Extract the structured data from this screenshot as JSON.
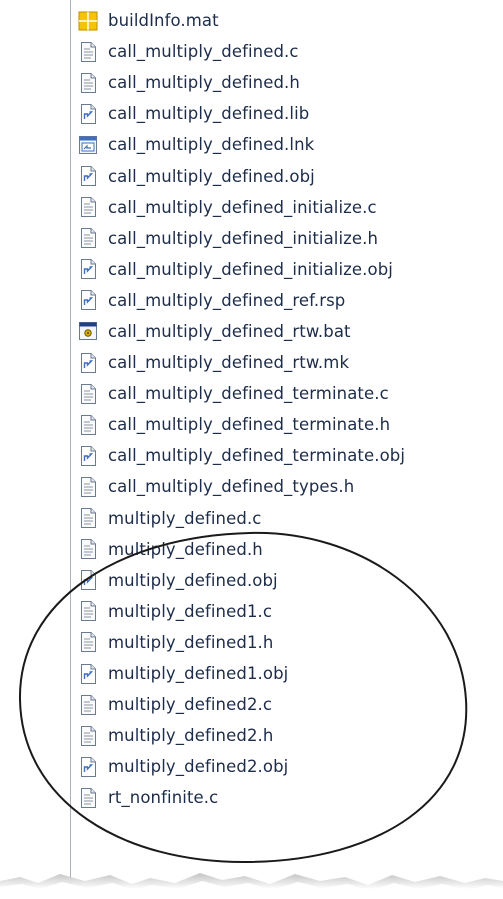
{
  "files": [
    {
      "name": "buildInfo.mat",
      "icon": "mat-file-icon"
    },
    {
      "name": "call_multiply_defined.c",
      "icon": "text-file-icon"
    },
    {
      "name": "call_multiply_defined.h",
      "icon": "text-file-icon"
    },
    {
      "name": "call_multiply_defined.lib",
      "icon": "object-file-icon"
    },
    {
      "name": "call_multiply_defined.lnk",
      "icon": "shortcut-file-icon"
    },
    {
      "name": "call_multiply_defined.obj",
      "icon": "object-file-icon"
    },
    {
      "name": "call_multiply_defined_initialize.c",
      "icon": "text-file-icon"
    },
    {
      "name": "call_multiply_defined_initialize.h",
      "icon": "text-file-icon"
    },
    {
      "name": "call_multiply_defined_initialize.obj",
      "icon": "object-file-icon"
    },
    {
      "name": "call_multiply_defined_ref.rsp",
      "icon": "object-file-icon"
    },
    {
      "name": "call_multiply_defined_rtw.bat",
      "icon": "batch-file-icon"
    },
    {
      "name": "call_multiply_defined_rtw.mk",
      "icon": "object-file-icon"
    },
    {
      "name": "call_multiply_defined_terminate.c",
      "icon": "text-file-icon"
    },
    {
      "name": "call_multiply_defined_terminate.h",
      "icon": "text-file-icon"
    },
    {
      "name": "call_multiply_defined_terminate.obj",
      "icon": "object-file-icon"
    },
    {
      "name": "call_multiply_defined_types.h",
      "icon": "text-file-icon"
    },
    {
      "name": "multiply_defined.c",
      "icon": "text-file-icon"
    },
    {
      "name": "multiply_defined.h",
      "icon": "text-file-icon"
    },
    {
      "name": "multiply_defined.obj",
      "icon": "object-file-icon"
    },
    {
      "name": "multiply_defined1.c",
      "icon": "text-file-icon"
    },
    {
      "name": "multiply_defined1.h",
      "icon": "text-file-icon"
    },
    {
      "name": "multiply_defined1.obj",
      "icon": "object-file-icon"
    },
    {
      "name": "multiply_defined2.c",
      "icon": "text-file-icon"
    },
    {
      "name": "multiply_defined2.h",
      "icon": "text-file-icon"
    },
    {
      "name": "multiply_defined2.obj",
      "icon": "object-file-icon"
    },
    {
      "name": "rt_nonfinite.c",
      "icon": "text-file-icon"
    }
  ],
  "colors": {
    "text": "#1d2c4a",
    "annotation_stroke": "#1a1a1a",
    "frame_border": "#a9b1bd",
    "icon_outline": "#6a7a90",
    "mat_icon_fill": "#f5c400",
    "object_icon_accent": "#3b6fc4"
  }
}
